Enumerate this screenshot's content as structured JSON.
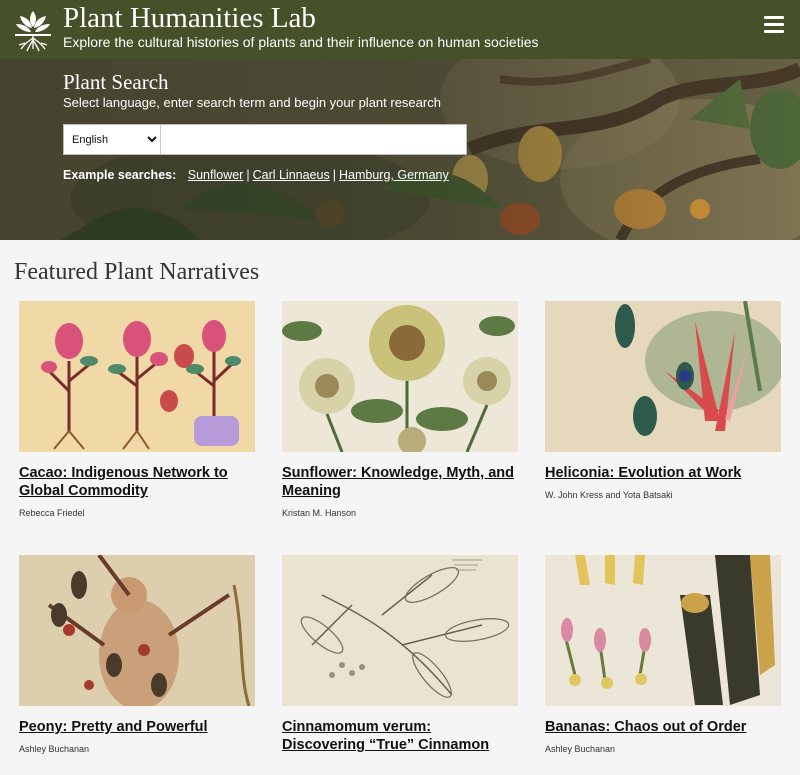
{
  "header": {
    "title": "Plant Humanities Lab",
    "tagline": "Explore the cultural histories of plants and their influence on human societies",
    "logo_icon": "plant-roots-logo-icon",
    "menu_icon": "hamburger-menu-icon"
  },
  "search": {
    "title": "Plant Search",
    "subtitle": "Select language, enter search term and begin your plant research",
    "language_selected": "English",
    "input_value": "",
    "examples_label": "Example searches:",
    "examples": [
      "Sunflower",
      "Carl Linnaeus",
      "Hamburg, Germany"
    ],
    "separator": "|"
  },
  "featured": {
    "title": "Featured Plant Narratives",
    "cards": [
      {
        "title": "Cacao: Indigenous Network to Global Commodity",
        "author": "Rebecca Friedel"
      },
      {
        "title": "Sunflower: Knowledge, Myth, and Meaning",
        "author": "Kristan M. Hanson"
      },
      {
        "title": "Heliconia: Evolution at Work",
        "author": "W. John Kress and Yota Batsaki"
      },
      {
        "title": "Peony: Pretty and Powerful",
        "author": "Ashley Buchanan"
      },
      {
        "title": "Cinnamomum verum: Discovering “True” Cinnamon",
        "author": ""
      },
      {
        "title": "Bananas: Chaos out of Order",
        "author": "Ashley Buchanan"
      }
    ]
  },
  "colors": {
    "header_bg": "#46512a",
    "page_bg": "#f5f5f5"
  }
}
